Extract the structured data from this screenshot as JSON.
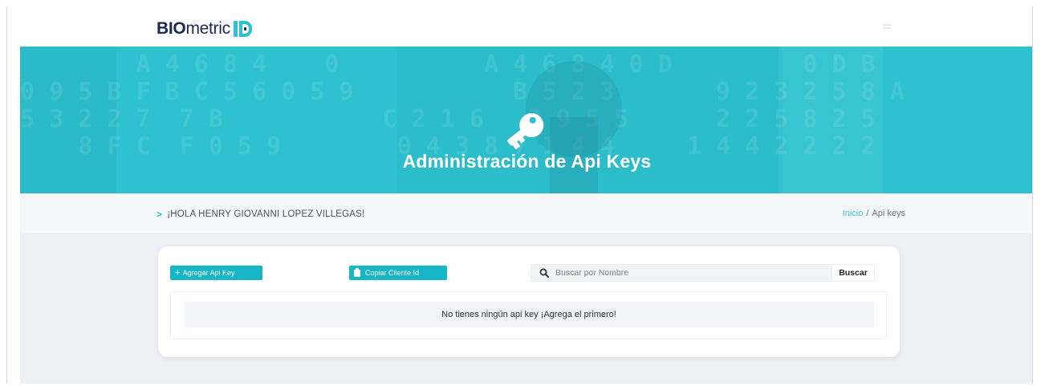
{
  "brand": {
    "name_bold": "BIO",
    "name_light": "metric",
    "accent": "#2ec2d0",
    "dark": "#1b2a55"
  },
  "hero": {
    "title": "Administración de Api Keys",
    "icon": "key-icon"
  },
  "greeting": "¡HOLA HENRY GIOVANNI LOPEZ VILLEGAS!",
  "breadcrumb": {
    "home": "Inicio",
    "separator": "/",
    "current": "Api keys"
  },
  "toolbar": {
    "add_label": "Agregar Api Key",
    "copy_label": "Copiar Cliente Id",
    "search_placeholder": "Buscar por Nombre",
    "search_button": "Buscar"
  },
  "table": {
    "empty_message": "No tienes ningún api key ¡Agrega el primero!"
  }
}
